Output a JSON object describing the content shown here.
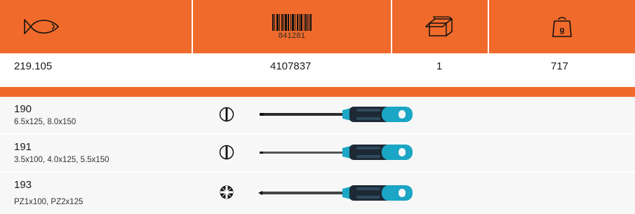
{
  "header": {
    "icons": [
      "fish-icon",
      "barcode-icon",
      "box-icon",
      "weight-icon"
    ],
    "barcode_number": "841281",
    "weight_label": "g"
  },
  "values": {
    "article": "219.105",
    "ean": "4107837",
    "quantity": "1",
    "weight": "717"
  },
  "colors": {
    "accent": "#ef6a2b",
    "handle_dark": "#1d2a36",
    "handle_teal": "#1aa6c4"
  },
  "items": [
    {
      "number": "190",
      "sizes": "6.5x125, 8.0x150",
      "tip": "slotted-tip-icon"
    },
    {
      "number": "191",
      "sizes": "3.5x100, 4.0x125, 5.5x150",
      "tip": "slotted-tip-icon"
    },
    {
      "number": "193",
      "sizes": "PZ1x100, PZ2x125",
      "tip": "pozidriv-tip-icon"
    }
  ]
}
